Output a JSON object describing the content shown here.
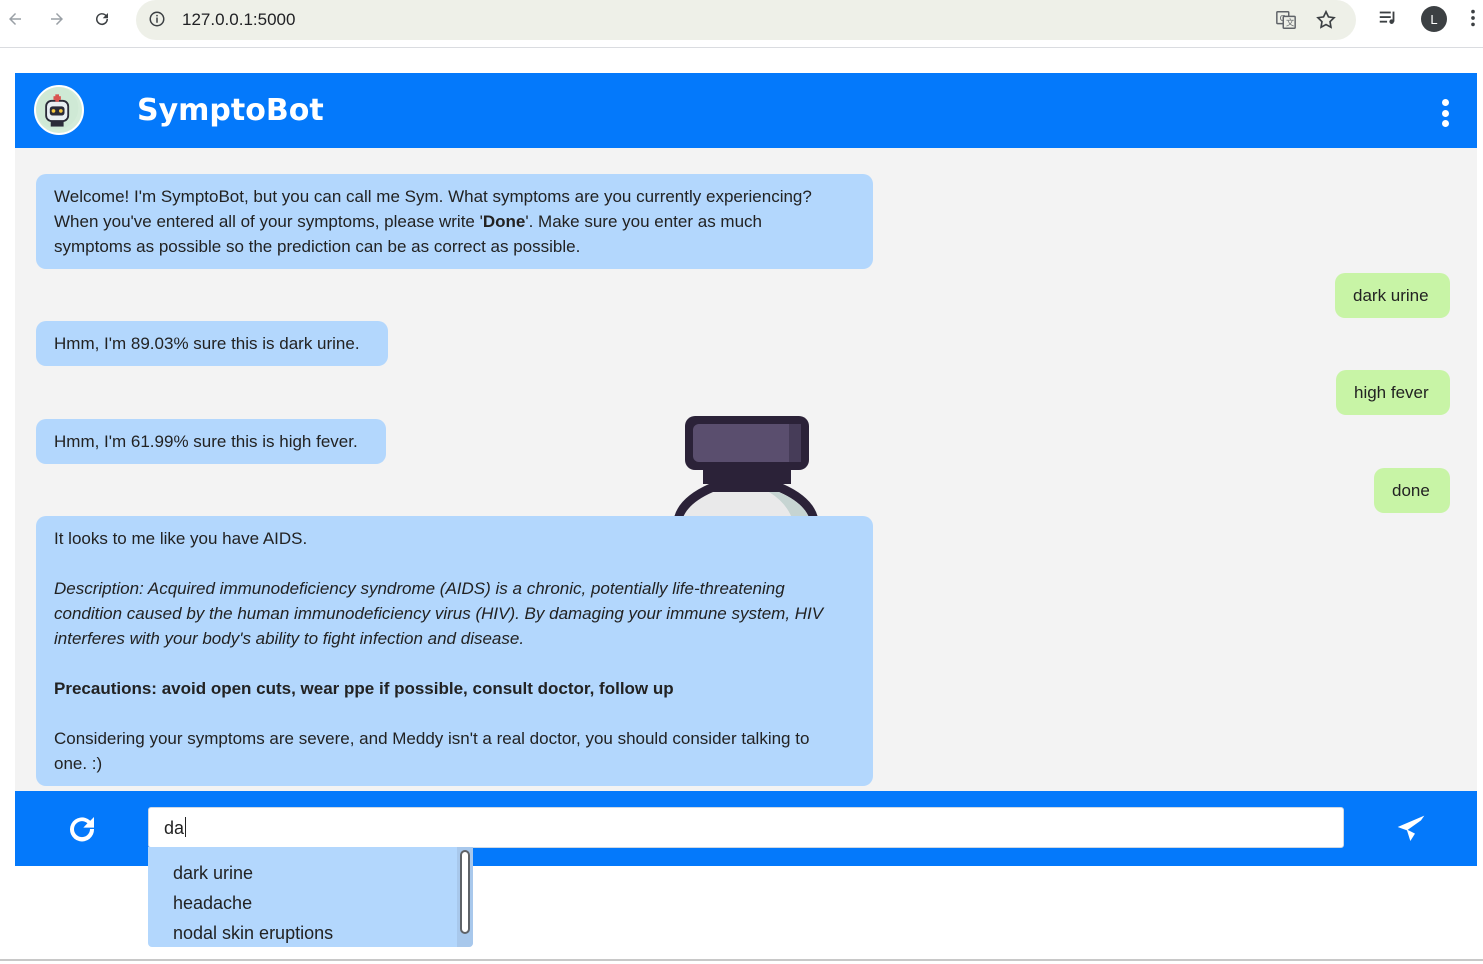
{
  "browser": {
    "url": "127.0.0.1:5000",
    "profile_initial": "L"
  },
  "app": {
    "title": "SymptoBot",
    "colors": {
      "header": "#0479fb",
      "bot_bubble": "#b3d7fd",
      "user_bubble": "#c8f4a6",
      "background": "#f3f3f3"
    }
  },
  "messages": {
    "welcome": {
      "line1": "Welcome! I'm SymptoBot, but you can call me Sym. What symptoms are you currently experiencing?",
      "line2_before": "When you've entered all of your symptoms, please write '",
      "line2_bold": "Done",
      "line2_after": "'. Make sure you enter as much",
      "line3": "symptoms as possible so the prediction can be as correct as possible."
    },
    "user1": "dark urine",
    "bot1": "Hmm, I'm 89.03% sure this is dark urine.",
    "user2": "high fever",
    "bot2": "Hmm, I'm 61.99% sure this is high fever.",
    "user3": "done",
    "result": {
      "diagnosis": "It looks to me like you have AIDS.",
      "description_l1": "Description: Acquired immunodeficiency syndrome (AIDS) is a chronic, potentially life-threatening",
      "description_l2": "condition caused by the human immunodeficiency virus (HIV). By damaging your immune system, HIV",
      "description_l3": "interferes with your body's ability to fight infection and disease.",
      "precautions": "Precautions: avoid open cuts, wear ppe if possible, consult doctor, follow up",
      "advice_l1": "Considering your symptoms are severe, and Meddy isn't a real doctor, you should consider talking to",
      "advice_l2": "one. :)"
    }
  },
  "input": {
    "value": "da"
  },
  "autocomplete": {
    "options": [
      "dark urine",
      "headache",
      "nodal skin eruptions"
    ]
  },
  "icons": {
    "back": "arrow-left-icon",
    "forward": "arrow-right-icon",
    "reload": "reload-icon",
    "info": "info-icon",
    "translate": "translate-icon",
    "bookmark": "star-icon",
    "media": "media-queue-icon",
    "menu": "kebab-menu-icon",
    "logo": "robot-doctor-icon",
    "reset": "refresh-icon",
    "send": "paper-plane-icon",
    "illustration": "medicine-bottle-icon"
  }
}
